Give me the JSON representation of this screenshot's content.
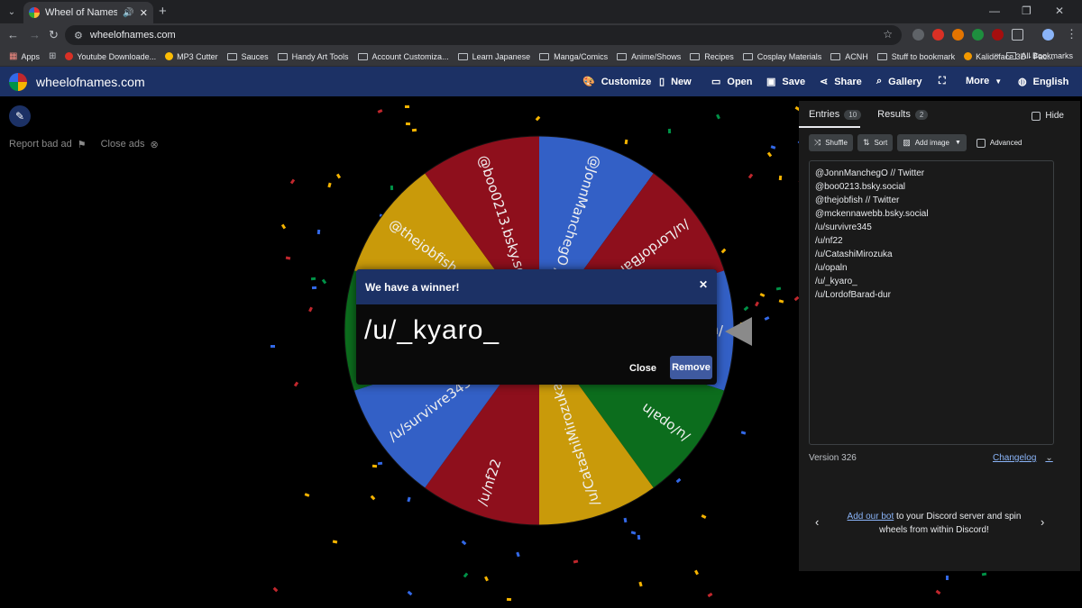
{
  "browser": {
    "tab_title": "Wheel of Names | Random",
    "url": "wheelofnames.com",
    "bookmarks": [
      "Apps",
      "Youtube Downloade...",
      "MP3 Cutter",
      "Sauces",
      "Handy Art Tools",
      "Account Customiza...",
      "Learn Japanese",
      "Manga/Comics",
      "Anime/Shows",
      "Recipes",
      "Cosplay Materials",
      "ACNH",
      "Stuff to bookmark",
      "Kalidoface 3D - Fac..."
    ],
    "bookmarks_all": "All Bookmarks",
    "extension_badge": "2"
  },
  "header": {
    "site_name": "wheelofnames.com",
    "menu": [
      "Customize",
      "New",
      "Open",
      "Save",
      "Share",
      "Gallery",
      "Fullscreen",
      "More",
      "English"
    ]
  },
  "ads": {
    "report": "Report bad ad",
    "close": "Close ads"
  },
  "wheel": {
    "segments": [
      {
        "label": "@JonnManchegO // Twitter",
        "color": "#3360c6"
      },
      {
        "label": "/u/LordofBarad-dur",
        "color": "#8e0f1c"
      },
      {
        "label": "/u/_kyaro_",
        "color": "#3360c6"
      },
      {
        "label": "/u/opaln",
        "color": "#0c6d1d"
      },
      {
        "label": "/u/CatashiMirozuka",
        "color": "#c99a0a"
      },
      {
        "label": "/u/nf22",
        "color": "#8e0f1c"
      },
      {
        "label": "/u/survivre345",
        "color": "#3360c6"
      },
      {
        "label": "@mckennawebb.bsky.social",
        "color": "#0c6d1d"
      },
      {
        "label": "@thejobfish // Twitter",
        "color": "#c99a0a"
      },
      {
        "label": "@boo0213.bsky.social",
        "color": "#8e0f1c"
      }
    ]
  },
  "modal": {
    "title": "We have a winner!",
    "winner": "/u/_kyaro_",
    "close_label": "Close",
    "remove_label": "Remove"
  },
  "panel": {
    "entries_tab": "Entries",
    "entries_count": "10",
    "results_tab": "Results",
    "results_count": "2",
    "hide_label": "Hide",
    "shuffle_label": "Shuffle",
    "sort_label": "Sort",
    "add_image_label": "Add image",
    "advanced_label": "Advanced",
    "entries": [
      "@JonnManchegO // Twitter",
      "@boo0213.bsky.social",
      "@thejobfish // Twitter",
      "@mckennawebb.bsky.social",
      "/u/survivre345",
      "/u/nf22",
      "/u/CatashiMirozuka",
      "/u/opaln",
      "/u/_kyaro_",
      "/u/LordofBarad-dur"
    ],
    "version": "Version 326",
    "changelog": "Changelog",
    "discord_link": "Add our bot",
    "discord_text": "to your Discord server and spin wheels from within Discord!"
  }
}
